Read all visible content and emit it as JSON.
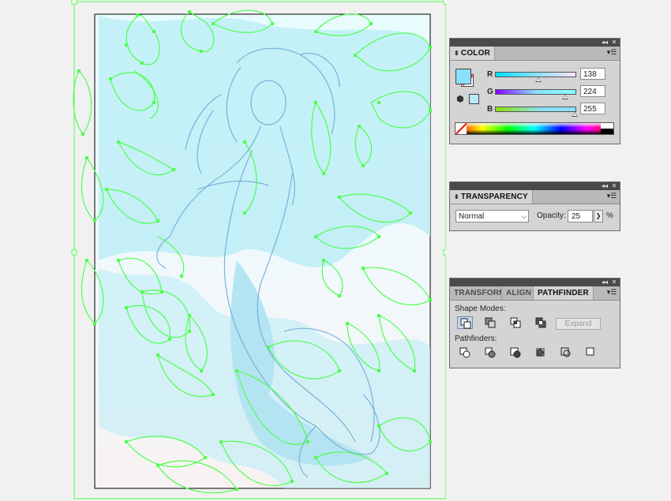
{
  "canvas": {
    "artboard_label": "",
    "path_color": "#4dff4d",
    "fill_color": "#bdeef6",
    "sketch_color": "#6aa7d6"
  },
  "panel_controls": {
    "collapse_icon": "◂◂",
    "close_icon": "✕",
    "menu_icon": "▾☰"
  },
  "color_panel": {
    "tab_label": "COLOR",
    "tab_arrows": "⬍",
    "fill_color": "#8ae0ff",
    "channels": [
      {
        "label": "R",
        "value": "138",
        "fraction": 0.541
      },
      {
        "label": "G",
        "value": "224",
        "fraction": 0.878
      },
      {
        "label": "B",
        "value": "255",
        "fraction": 1.0
      }
    ]
  },
  "transparency_panel": {
    "tab_label": "TRANSPARENCY",
    "tab_arrows": "⬍",
    "blend_mode": "Normal",
    "opacity_label": "Opacity:",
    "opacity_value": "25",
    "opacity_unit": "%"
  },
  "pathfinder_panel": {
    "tabs": [
      "TRANSFORM",
      "ALIGN",
      "PATHFINDER"
    ],
    "active_tab": "PATHFINDER",
    "shape_modes_label": "Shape Modes:",
    "pathfinders_label": "Pathfinders:",
    "expand_label": "Expand",
    "shape_mode_buttons": [
      "unite-icon",
      "minus-front-icon",
      "intersect-icon",
      "exclude-icon"
    ],
    "pathfinder_buttons": [
      "divide-icon",
      "trim-icon",
      "merge-icon",
      "crop-icon",
      "outline-icon",
      "minus-back-icon"
    ]
  }
}
